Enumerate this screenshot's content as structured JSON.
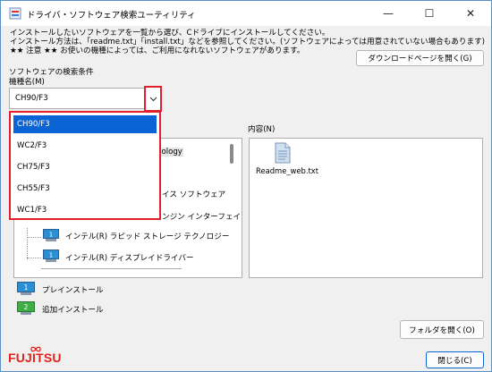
{
  "window": {
    "title": "ドライバ・ソフトウェア検索ユーティリティ"
  },
  "titlebar": {
    "minimize": "—",
    "maximize": "☐",
    "close": "✕"
  },
  "instructions": {
    "line1": "インストールしたいソフトウェアを一覧から選び、Cドライブにインストールしてください。",
    "line2": "インストール方法は、「readme.txt」「install.txt」などを参照してください。(ソフトウェアによっては用意されていない場合もあります)",
    "line3": "★★ 注意 ★★ お使いの機種によっては、ご利用になれないソフトウェアがあります。"
  },
  "download_button": "ダウンロードページを開く(G)",
  "search": {
    "section_label": "ソフトウェアの検索条件",
    "model_label": "機種名(M)",
    "model_value": "CH90/F3"
  },
  "dropdown": {
    "options": [
      "CH90/F3",
      "WC2/F3",
      "CH75/F3",
      "CH55/F3",
      "WC1/F3"
    ]
  },
  "tree": {
    "partial1": "nology",
    "partial2": "イス ソフトウェア",
    "partial3": "ンジン インターフェイ",
    "item1": "インテル(R) ラピッド ストレージ テクノロジー",
    "item2": "インテル(R) ディスプレイドライバー"
  },
  "content": {
    "label": "内容(N)",
    "file_name": "Readme_web.txt"
  },
  "legend": {
    "preinstall": "プレインストール",
    "additional": "追加インストール",
    "preinstall_num": "1",
    "additional_num": "2"
  },
  "open_folder_button": "フォルダを開く(O)",
  "brand": {
    "logo": "FUJITSU"
  },
  "close_button": "閉じる(C)",
  "colors": {
    "accent": "#0a64d6",
    "highlight_border": "#e0202c",
    "brand_red": "#e2231a"
  }
}
